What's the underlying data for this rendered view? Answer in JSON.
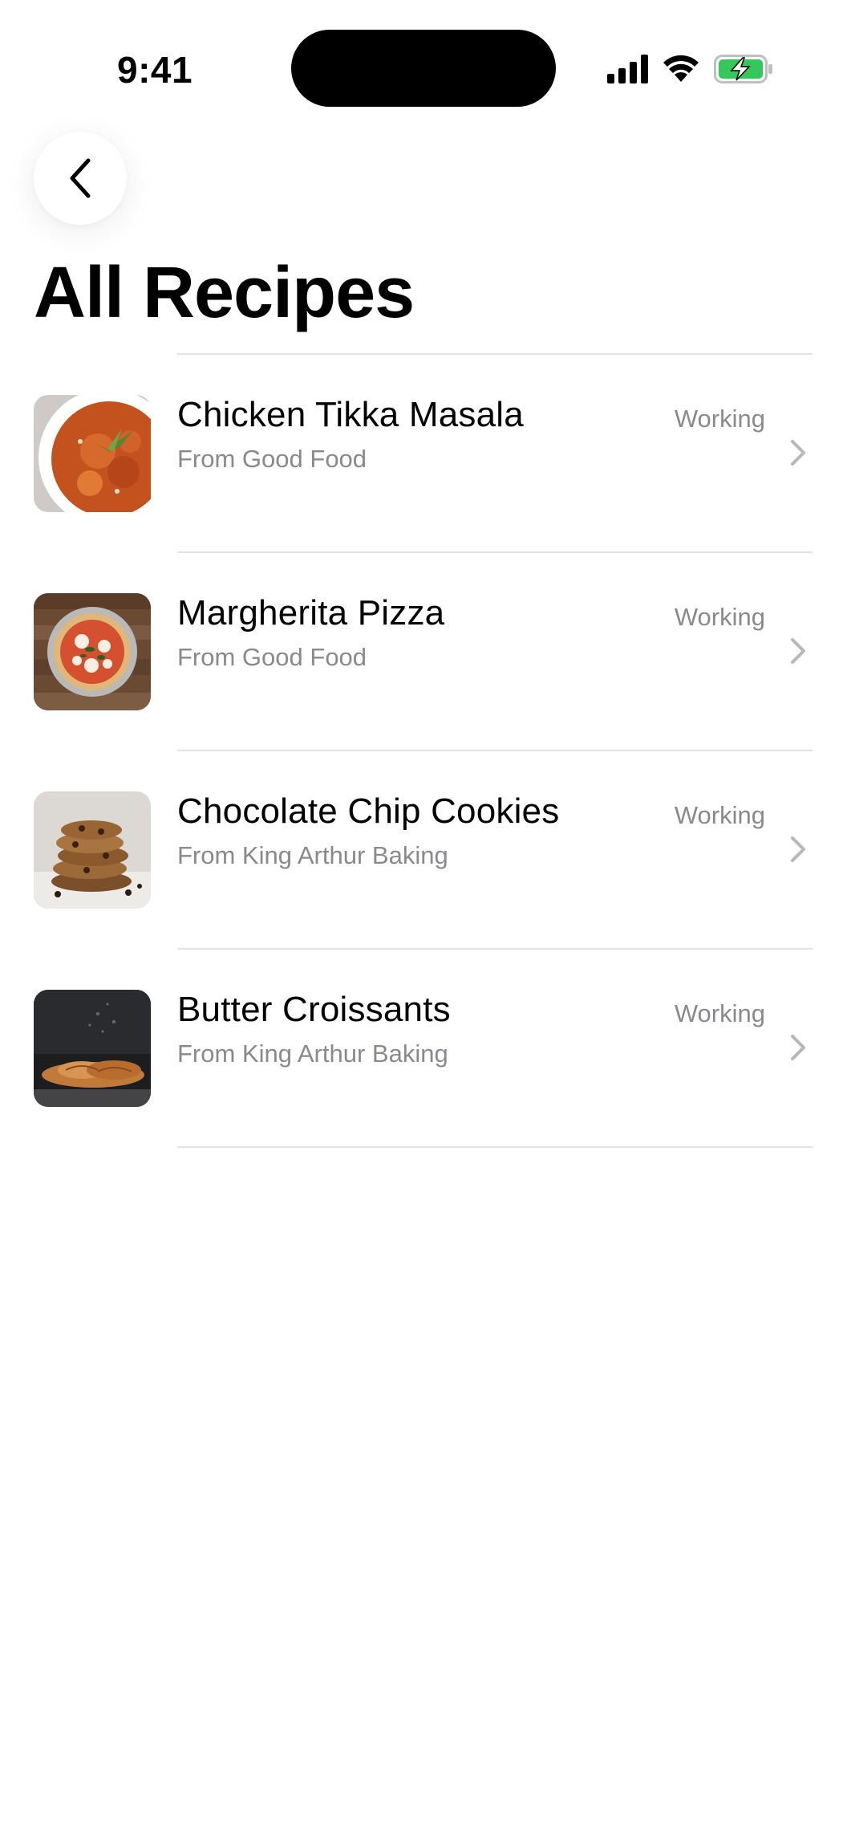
{
  "status_bar": {
    "time": "9:41",
    "icons": [
      "signal-icon",
      "wifi-icon",
      "battery-charging-icon"
    ],
    "battery_color": "#34c759"
  },
  "navigation": {
    "back_icon": "chevron-left-icon"
  },
  "page": {
    "title": "All Recipes"
  },
  "recipes": [
    {
      "name": "Chicken Tikka Masala",
      "source": "From Good Food",
      "status": "Working",
      "image": "chicken-tikka-masala-photo"
    },
    {
      "name": "Margherita Pizza",
      "source": "From Good Food",
      "status": "Working",
      "image": "margherita-pizza-photo"
    },
    {
      "name": "Chocolate Chip Cookies",
      "source": "From King Arthur Baking",
      "status": "Working",
      "image": "chocolate-chip-cookies-photo"
    },
    {
      "name": "Butter Croissants",
      "source": "From King Arthur Baking",
      "status": "Working",
      "image": "butter-croissants-photo"
    }
  ]
}
